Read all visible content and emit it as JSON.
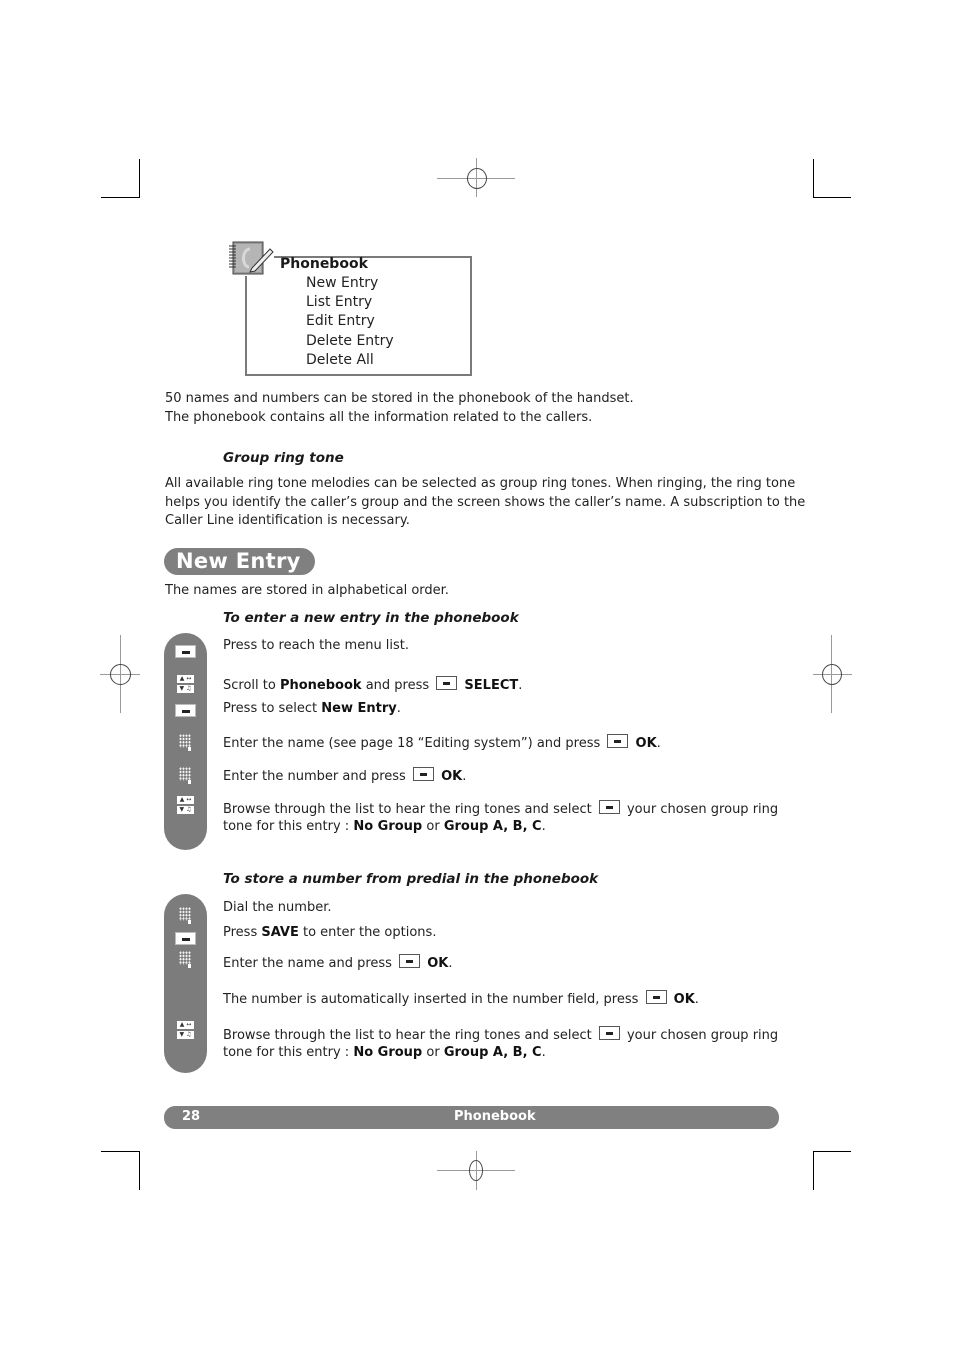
{
  "menu": {
    "title": "Phonebook",
    "icon": "phonebook-notepad-icon",
    "items": [
      "New Entry",
      "List Entry",
      "Edit Entry",
      "Delete Entry",
      "Delete All"
    ]
  },
  "intro": {
    "line1": "50 names and numbers can be stored in the phonebook of the handset.",
    "line2": "The phonebook contains all the information related to the callers."
  },
  "group_ring_tone": {
    "heading": "Group ring tone",
    "lines": [
      "All available ring tone melodies can be selected as group ring tones. When ringing, the ring tone",
      "helps you identify the caller’s group and the screen shows the caller’s name. A subscription to the",
      "Caller Line identification is necessary."
    ]
  },
  "new_entry": {
    "section_title": "New Entry",
    "intro": "The names are stored in alphabetical order.",
    "procedure1": {
      "heading": "To enter a new entry in the phonebook",
      "icons": [
        "menu-key-icon",
        "navigation-keys-icon",
        "menu-key-icon",
        "keypad-icon",
        "keypad-icon",
        "navigation-keys-icon"
      ],
      "steps": [
        {
          "text": "Press to reach the menu list."
        },
        {
          "pre": "Scroll to ",
          "bold1": "Phonebook",
          "mid": " and press ",
          "key": "softkey-icon",
          "bold2": "SELECT",
          "post": "."
        },
        {
          "pre": "Press to select ",
          "bold1": "New Entry",
          "post": "."
        },
        {
          "pre": "Enter the name (see page 18 “Editing system”) and press ",
          "key": "softkey-icon",
          "bold2": "OK",
          "post": "."
        },
        {
          "pre": "Enter the number and press ",
          "key": "softkey-icon",
          "bold2": "OK",
          "post": "."
        },
        {
          "pre": "Browse through the list to hear the ring tones and select ",
          "key": "softkey-icon",
          "post": " your chosen group ring",
          "line2_pre": "tone for this entry : ",
          "line2_bold1": "No Group",
          "line2_mid": " or ",
          "line2_bold2": "Group A, B, C",
          "line2_post": "."
        }
      ]
    },
    "procedure2": {
      "heading": "To store a number from predial in the phonebook",
      "icons": [
        "keypad-icon",
        "menu-key-icon",
        "keypad-icon",
        "navigation-keys-icon"
      ],
      "steps": [
        {
          "text": "Dial the number."
        },
        {
          "pre": "Press ",
          "bold1": "SAVE",
          "post": " to enter the options."
        },
        {
          "pre": "Enter the name and press ",
          "key": "softkey-icon",
          "bold2": "OK",
          "post": "."
        },
        {
          "pre": "The number is automatically inserted in the number field, press ",
          "key": "softkey-icon",
          "bold2": "OK",
          "post": "."
        },
        {
          "pre": "Browse through the list to hear the ring tones and select ",
          "key": "softkey-icon",
          "post": " your chosen group ring",
          "line2_pre": "tone for this entry : ",
          "line2_bold1": "No Group",
          "line2_mid": " or ",
          "line2_bold2": "Group A, B, C",
          "line2_post": "."
        }
      ]
    }
  },
  "nav_symbols": {
    "up": "▲ ↔",
    "down": "▼ ♫"
  },
  "footer": {
    "page_number": "28",
    "section": "Phonebook"
  },
  "colors": {
    "accent_gray": "#808080",
    "icon_column": "#7c7c7c",
    "text": "#222222"
  }
}
